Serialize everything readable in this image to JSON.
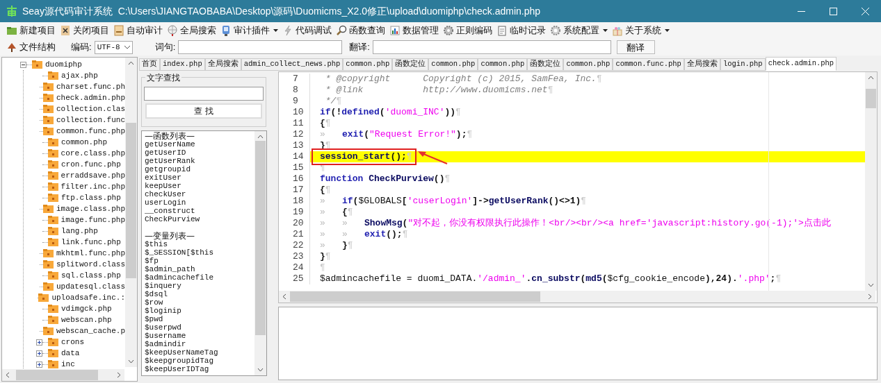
{
  "window": {
    "title": "Seay源代码审计系统  C:\\Users\\JIANGTAOBABA\\Desktop\\源码\\Duomicms_X2.0修正\\upload\\duomiphp\\check.admin.php"
  },
  "toolbar": [
    {
      "label": "新建项目",
      "dropdown": false
    },
    {
      "label": "关闭项目",
      "dropdown": false
    },
    {
      "label": "自动审计",
      "dropdown": false
    },
    {
      "label": "全局搜索",
      "dropdown": false
    },
    {
      "label": "审计插件",
      "dropdown": true
    },
    {
      "label": "代码调试",
      "dropdown": false
    },
    {
      "label": "函数查询",
      "dropdown": false
    },
    {
      "label": "数据管理",
      "dropdown": false
    },
    {
      "label": "正则编码",
      "dropdown": false
    },
    {
      "label": "临时记录",
      "dropdown": false
    },
    {
      "label": "系统配置",
      "dropdown": true
    },
    {
      "label": "关于系统",
      "dropdown": true
    }
  ],
  "toolbar2": {
    "structure_button": "文件结构",
    "encoding_label": "编码:",
    "encoding_value": "UTF-8",
    "query_label": "词句:",
    "translate_label": "翻译:",
    "translate_button": "翻译"
  },
  "tree": [
    {
      "label": "duomiphp",
      "kind": "folder",
      "expanded": true,
      "children": [
        {
          "label": "ajax.php",
          "kind": "file"
        },
        {
          "label": "charset.func.ph",
          "kind": "file"
        },
        {
          "label": "check.admin.php",
          "kind": "file"
        },
        {
          "label": "collection.clas",
          "kind": "file"
        },
        {
          "label": "collection.func",
          "kind": "file"
        },
        {
          "label": "common.func.php",
          "kind": "file"
        },
        {
          "label": "common.php",
          "kind": "file"
        },
        {
          "label": "core.class.php",
          "kind": "file"
        },
        {
          "label": "cron.func.php",
          "kind": "file"
        },
        {
          "label": "erraddsave.php",
          "kind": "file"
        },
        {
          "label": "filter.inc.php",
          "kind": "file"
        },
        {
          "label": "ftp.class.php",
          "kind": "file"
        },
        {
          "label": "image.class.php",
          "kind": "file"
        },
        {
          "label": "image.func.php",
          "kind": "file"
        },
        {
          "label": "lang.php",
          "kind": "file"
        },
        {
          "label": "link.func.php",
          "kind": "file"
        },
        {
          "label": "mkhtml.func.php",
          "kind": "file"
        },
        {
          "label": "splitword.class",
          "kind": "file"
        },
        {
          "label": "sql.class.php",
          "kind": "file"
        },
        {
          "label": "updatesql.class",
          "kind": "file"
        },
        {
          "label": "uploadsafe.inc.:",
          "kind": "file"
        },
        {
          "label": "vdimgck.php",
          "kind": "file"
        },
        {
          "label": "webscan.php",
          "kind": "file"
        },
        {
          "label": "webscan_cache.p",
          "kind": "file"
        },
        {
          "label": "crons",
          "kind": "folder",
          "expanded": false
        },
        {
          "label": "data",
          "kind": "folder",
          "expanded": false
        },
        {
          "label": "inc",
          "kind": "folder",
          "expanded": false
        }
      ]
    }
  ],
  "tabs": [
    {
      "label": "首页",
      "selected": false
    },
    {
      "label": "index.php",
      "selected": false
    },
    {
      "label": "全局搜索",
      "selected": false
    },
    {
      "label": "admin_collect_news.php",
      "selected": false
    },
    {
      "label": "common.php",
      "selected": false
    },
    {
      "label": "函数定位",
      "selected": false
    },
    {
      "label": "common.php",
      "selected": false
    },
    {
      "label": "common.php",
      "selected": false
    },
    {
      "label": "函数定位",
      "selected": false
    },
    {
      "label": "common.php",
      "selected": false
    },
    {
      "label": "common.func.php",
      "selected": false
    },
    {
      "label": "全局搜索",
      "selected": false
    },
    {
      "label": "login.php",
      "selected": false
    },
    {
      "label": "check.admin.php",
      "selected": true
    }
  ],
  "find_panel": {
    "title": "文字查找",
    "button": "查 找"
  },
  "symbol_list": [
    {
      "kind": "heading",
      "text": "—函数列表—"
    },
    {
      "kind": "item",
      "text": "getUserName"
    },
    {
      "kind": "item",
      "text": "getUserID"
    },
    {
      "kind": "item",
      "text": "getUserRank"
    },
    {
      "kind": "item",
      "text": "getgroupid"
    },
    {
      "kind": "item",
      "text": "exitUser"
    },
    {
      "kind": "item",
      "text": "keepUser"
    },
    {
      "kind": "item",
      "text": "checkUser"
    },
    {
      "kind": "item",
      "text": "userLogin"
    },
    {
      "kind": "item",
      "text": "__construct"
    },
    {
      "kind": "item",
      "text": "CheckPurview"
    },
    {
      "kind": "blank"
    },
    {
      "kind": "heading",
      "text": "—变量列表—"
    },
    {
      "kind": "item",
      "text": "$this"
    },
    {
      "kind": "item",
      "text": "$_SESSION[$this"
    },
    {
      "kind": "item",
      "text": "$fp"
    },
    {
      "kind": "item",
      "text": "$admin_path"
    },
    {
      "kind": "item",
      "text": "$admincachefile"
    },
    {
      "kind": "item",
      "text": "$inquery"
    },
    {
      "kind": "item",
      "text": "$dsql"
    },
    {
      "kind": "item",
      "text": "$row"
    },
    {
      "kind": "item",
      "text": "$loginip"
    },
    {
      "kind": "item",
      "text": "$pwd"
    },
    {
      "kind": "item",
      "text": "$userpwd"
    },
    {
      "kind": "item",
      "text": "$username"
    },
    {
      "kind": "item",
      "text": "$admindir"
    },
    {
      "kind": "item",
      "text": "$keepUserNameTag"
    },
    {
      "kind": "item",
      "text": "$keepgroupidTag"
    },
    {
      "kind": "item",
      "text": "$keepUserIDTag"
    }
  ],
  "code": [
    {
      "n": "7",
      "tokens": [
        {
          "kind": "comment",
          "t": " * @copyright      Copyright (c) 2015, SamFea, Inc."
        }
      ],
      "eol": "¶",
      "highlighted": false,
      "marked": false
    },
    {
      "n": "8",
      "tokens": [
        {
          "kind": "comment",
          "t": " * @link           http://www.duomicms.net"
        }
      ],
      "eol": "¶",
      "highlighted": false,
      "marked": false
    },
    {
      "n": "9",
      "tokens": [
        {
          "kind": "comment",
          "t": " */"
        }
      ],
      "eol": "¶",
      "highlighted": false,
      "marked": false
    },
    {
      "n": "10",
      "tokens": [
        {
          "kind": "keyword",
          "t": "if"
        },
        {
          "kind": "op",
          "t": "(!"
        },
        {
          "kind": "keyword",
          "t": "defined"
        },
        {
          "kind": "op",
          "t": "("
        },
        {
          "kind": "string",
          "t": "'duomi_INC'"
        },
        {
          "kind": "op",
          "t": "))"
        }
      ],
      "eol": "¶",
      "highlighted": false,
      "marked": false
    },
    {
      "n": "11",
      "tokens": [
        {
          "kind": "op",
          "t": "{"
        }
      ],
      "eol": "¶",
      "highlighted": false,
      "marked": false
    },
    {
      "n": "12",
      "indent": [
        "»"
      ],
      "tokens": [
        {
          "kind": "keyword",
          "t": "exit"
        },
        {
          "kind": "op",
          "t": "("
        },
        {
          "kind": "string",
          "t": "\"Request Error!\""
        },
        {
          "kind": "op",
          "t": ");"
        }
      ],
      "eol": "¶",
      "highlighted": false,
      "marked": false
    },
    {
      "n": "13",
      "tokens": [
        {
          "kind": "op",
          "t": "}"
        }
      ],
      "eol": "¶",
      "highlighted": false,
      "marked": false
    },
    {
      "n": "14",
      "tokens": [
        {
          "kind": "function",
          "t": "session_start"
        },
        {
          "kind": "op",
          "t": "();"
        }
      ],
      "eol": "¶",
      "highlighted": true,
      "marked": true
    },
    {
      "n": "15",
      "eol": "¶",
      "highlighted": false,
      "marked": false
    },
    {
      "n": "16",
      "tokens": [
        {
          "kind": "keyword",
          "t": "function "
        },
        {
          "kind": "function",
          "t": "CheckPurview"
        },
        {
          "kind": "op",
          "t": "()"
        }
      ],
      "eol": "¶",
      "highlighted": false,
      "marked": false
    },
    {
      "n": "17",
      "tokens": [
        {
          "kind": "op",
          "t": "{"
        }
      ],
      "eol": "¶",
      "highlighted": false,
      "marked": false
    },
    {
      "n": "18",
      "indent": [
        "»"
      ],
      "tokens": [
        {
          "kind": "keyword",
          "t": "if"
        },
        {
          "kind": "op",
          "t": "("
        },
        {
          "kind": "variable",
          "t": "$GLOBALS"
        },
        {
          "kind": "op",
          "t": "["
        },
        {
          "kind": "string",
          "t": "'cuserLogin'"
        },
        {
          "kind": "op",
          "t": "]->"
        },
        {
          "kind": "function",
          "t": "getUserRank"
        },
        {
          "kind": "op",
          "t": "()<>1)"
        }
      ],
      "eol": "¶",
      "highlighted": false,
      "marked": false
    },
    {
      "n": "19",
      "indent": [
        "»"
      ],
      "tokens": [
        {
          "kind": "op",
          "t": "{"
        }
      ],
      "eol": "¶",
      "highlighted": false,
      "marked": false
    },
    {
      "n": "20",
      "indent": [
        "»",
        "»"
      ],
      "tokens": [
        {
          "kind": "function",
          "t": "ShowMsg"
        },
        {
          "kind": "op",
          "t": "("
        },
        {
          "kind": "string",
          "t": "\"对不起，你没有权限执行此操作！"
        },
        {
          "kind": "string",
          "t": "<br/><br/><a href='javascript:history.go(-1);'>点击此"
        }
      ],
      "highlighted": false,
      "marked": false
    },
    {
      "n": "21",
      "indent": [
        "»",
        "»"
      ],
      "tokens": [
        {
          "kind": "keyword",
          "t": "exit"
        },
        {
          "kind": "op",
          "t": "();"
        }
      ],
      "eol": "¶",
      "highlighted": false,
      "marked": false
    },
    {
      "n": "22",
      "indent": [
        "»"
      ],
      "tokens": [
        {
          "kind": "op",
          "t": "}"
        }
      ],
      "eol": "¶",
      "highlighted": false,
      "marked": false
    },
    {
      "n": "23",
      "tokens": [
        {
          "kind": "op",
          "t": "}"
        }
      ],
      "eol": "¶",
      "highlighted": false,
      "marked": false
    },
    {
      "n": "24",
      "eol": "¶",
      "highlighted": false,
      "marked": false
    },
    {
      "n": "25",
      "tokens": [
        {
          "kind": "variable",
          "t": "$admincachefile"
        },
        {
          "kind": "plain",
          "t": " = duomi_DATA."
        },
        {
          "kind": "string",
          "t": "'/admin_'"
        },
        {
          "kind": "op",
          "t": "."
        },
        {
          "kind": "function",
          "t": "cn_substr"
        },
        {
          "kind": "op",
          "t": "("
        },
        {
          "kind": "function",
          "t": "md5"
        },
        {
          "kind": "op",
          "t": "("
        },
        {
          "kind": "variable",
          "t": "$cfg_cookie_encode"
        },
        {
          "kind": "op",
          "t": "),24)."
        },
        {
          "kind": "string",
          "t": "'.php'"
        },
        {
          "kind": "op",
          "t": ";"
        }
      ],
      "eol": "¶",
      "highlighted": false,
      "marked": false
    }
  ]
}
